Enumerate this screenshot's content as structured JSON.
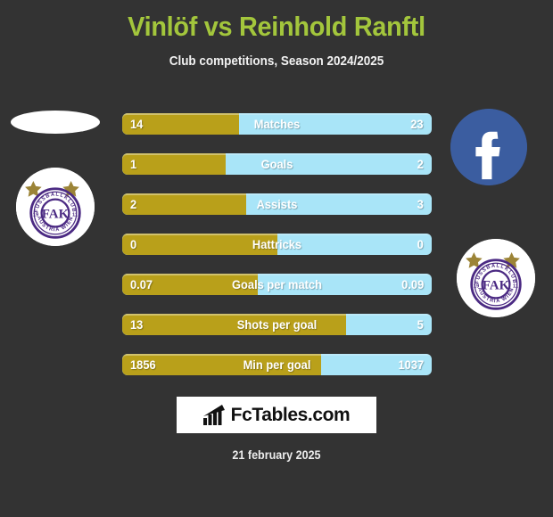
{
  "header": {
    "title": "Vinlöf vs Reinhold Ranftl",
    "subtitle": "Club competitions, Season 2024/2025",
    "title_color": "#a3c63c"
  },
  "colors": {
    "background": "#333333",
    "left_bar": "#b9a01a",
    "right_bar": "#a9e5f8",
    "facebook_blue": "#3b5da0",
    "crest_purple": "#4b2a83",
    "crest_gold": "#9c8437"
  },
  "stats": [
    {
      "label": "Matches",
      "left": "14",
      "right": "23",
      "left_pct": 37.8
    },
    {
      "label": "Goals",
      "left": "1",
      "right": "2",
      "left_pct": 33.3
    },
    {
      "label": "Assists",
      "left": "2",
      "right": "3",
      "left_pct": 40.0
    },
    {
      "label": "Hattricks",
      "left": "0",
      "right": "0",
      "left_pct": 50.0
    },
    {
      "label": "Goals per match",
      "left": "0.07",
      "right": "0.09",
      "left_pct": 43.8
    },
    {
      "label": "Shots per goal",
      "left": "13",
      "right": "5",
      "left_pct": 72.2
    },
    {
      "label": "Min per goal",
      "left": "1856",
      "right": "1037",
      "left_pct": 64.2
    }
  ],
  "crest": {
    "top_text": "FUSSBALLKLUB",
    "bottom_text": "AUSTRIA WIEN",
    "monogram": "FAK",
    "year_left": "19",
    "year_right": "11"
  },
  "footer": {
    "logo_text": "FcTables.com",
    "date": "21 february 2025"
  }
}
